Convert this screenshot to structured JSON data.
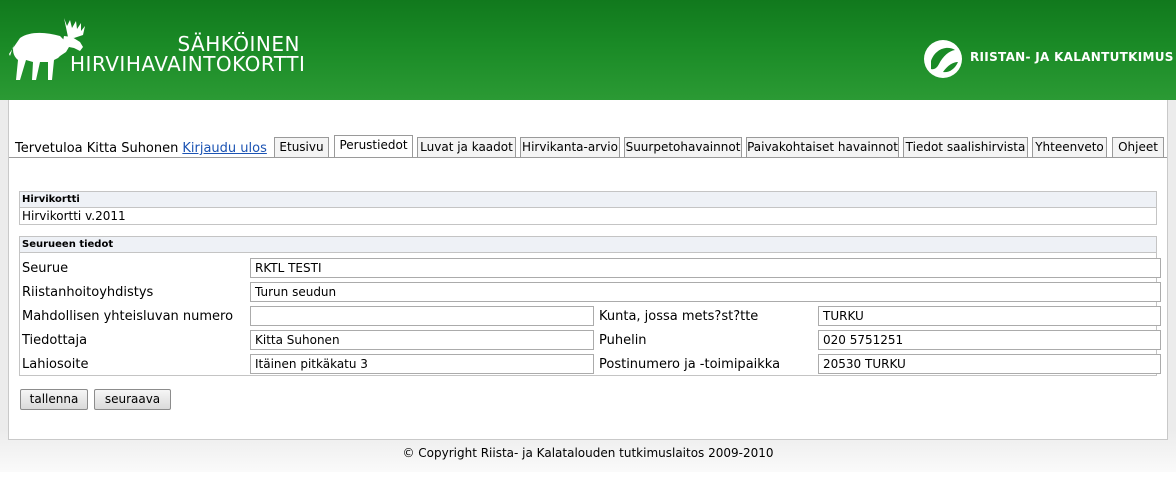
{
  "header": {
    "title_line1": "SÄHKÖINEN",
    "title_line2": "HIRVIHAVAINTOKORTTI",
    "logo_icon": "moose-icon",
    "org_logo_icon": "fish-leaf-icon",
    "org_name": "RIISTAN- JA KALANTUTKIMUS",
    "colors": {
      "header_green": "#1a8a26",
      "text": "#ffffff"
    }
  },
  "welcome": {
    "text": "Tervetuloa Kitta Suhonen",
    "logout": "Kirjaudu ulos"
  },
  "tabs": [
    {
      "label": "Etusivu"
    },
    {
      "label": "Perustiedot",
      "active": true
    },
    {
      "label": "Luvat ja kaadot"
    },
    {
      "label": "Hirvikanta-arvio"
    },
    {
      "label": "Suurpetohavainnot"
    },
    {
      "label": "Paivakohtaiset havainnot"
    },
    {
      "label": "Tiedot saalishirvista"
    },
    {
      "label": "Yhteenveto"
    },
    {
      "label": "Ohjeet"
    }
  ],
  "card_section": {
    "heading": "Hirvikortti",
    "value": "Hirvikortti v.2011"
  },
  "party_section": {
    "heading": "Seurueen tiedot",
    "seurue": {
      "label": "Seurue",
      "value": "RKTL TESTI"
    },
    "rhy": {
      "label": "Riistanhoitoyhdistys",
      "value": "Turun seudun"
    },
    "permit_no": {
      "label": "Mahdollisen yhteisluvan numero",
      "value": ""
    },
    "municipality": {
      "label": "Kunta, jossa mets?st?tte",
      "value": "TURKU"
    },
    "contact": {
      "label": "Tiedottaja",
      "value": "Kitta Suhonen"
    },
    "phone": {
      "label": "Puhelin",
      "value": "020 5751251"
    },
    "address": {
      "label": "Lahiosoite",
      "value": "Itäinen pitkäkatu 3"
    },
    "postal": {
      "label": "Postinumero ja -toimipaikka",
      "value": "20530 TURKU"
    }
  },
  "buttons": {
    "save": "tallenna",
    "next": "seuraava"
  },
  "footer": {
    "copyright": "© Copyright Riista- ja Kalatalouden tutkimuslaitos 2009-2010"
  }
}
